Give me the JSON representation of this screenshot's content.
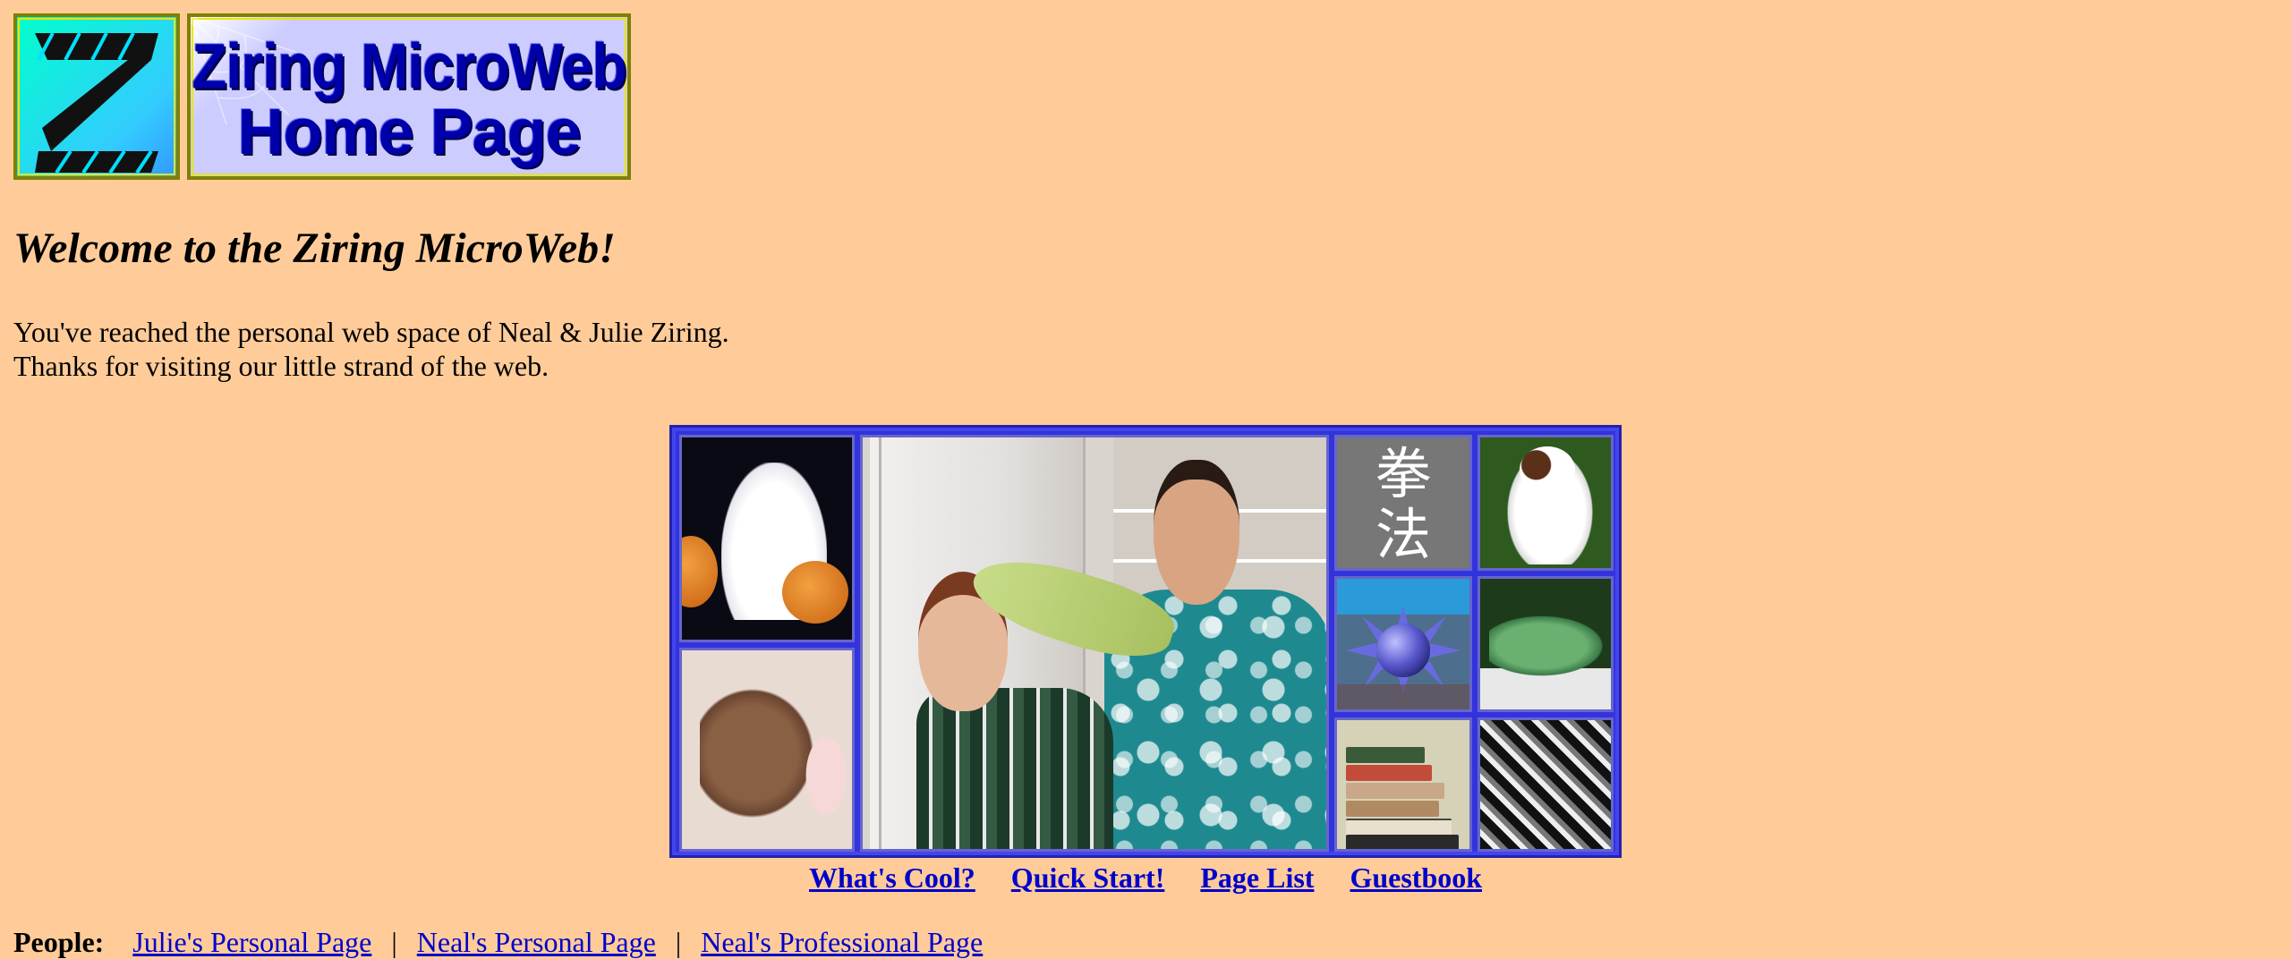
{
  "header": {
    "logo_z_letter": "Z",
    "banner_line1": "Ziring MicroWeb",
    "banner_line2": "Home Page"
  },
  "welcome": {
    "title": "Welcome to the Ziring MicroWeb!",
    "intro_line1": "You've reached the personal web space of Neal & Julie Ziring.",
    "intro_line2": "Thanks for visiting our little strand of the web."
  },
  "collage": {
    "kanji_top": "拳",
    "kanji_bottom": "法"
  },
  "nav": {
    "links": [
      "What's Cool?",
      "Quick Start!",
      "Page List",
      "Guestbook"
    ]
  },
  "people": {
    "label": "People:",
    "links": [
      "Julie's Personal Page",
      "Neal's Personal Page",
      "Neal's Professional Page"
    ],
    "separator": "|"
  },
  "colors": {
    "background": "#FFCC99",
    "link": "#0000CC",
    "collage_frame": "#3333DD"
  }
}
